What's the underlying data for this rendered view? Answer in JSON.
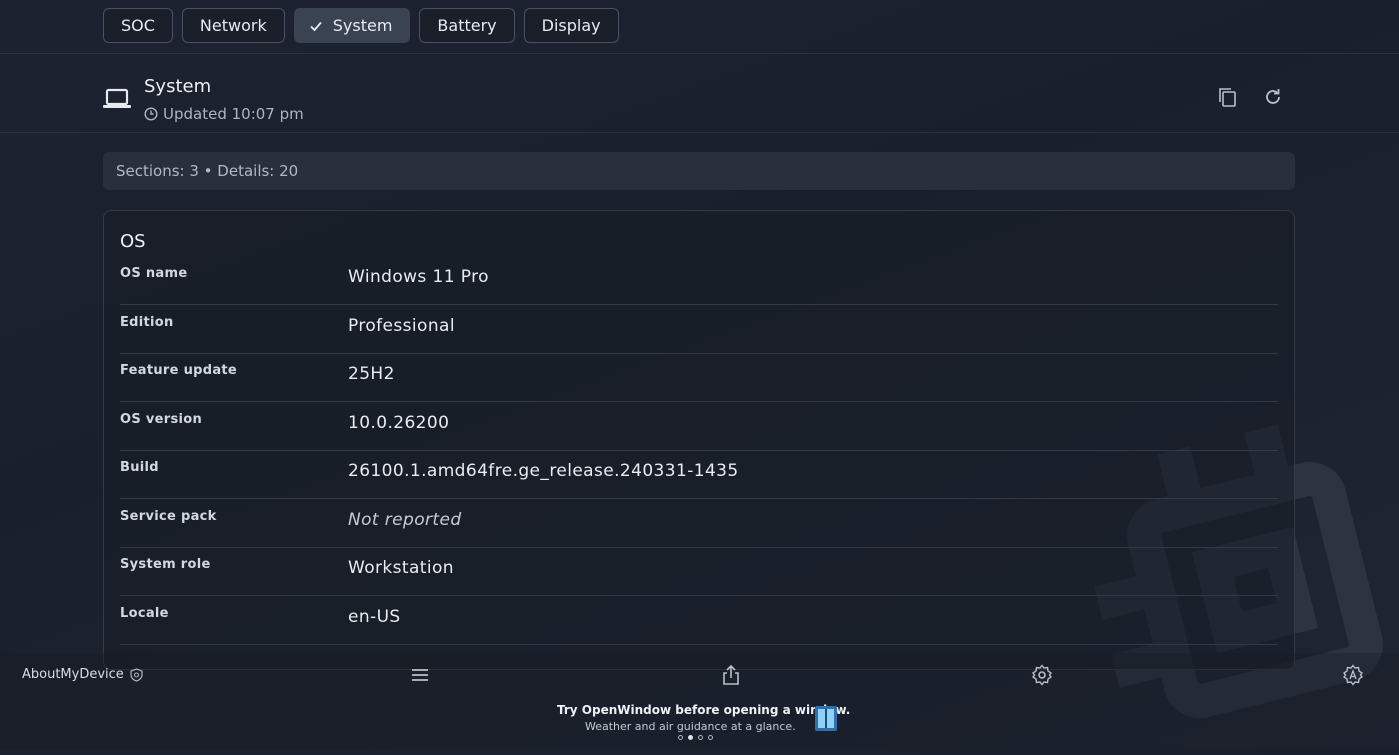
{
  "tabs": [
    {
      "label": "SOC",
      "active": false
    },
    {
      "label": "Network",
      "active": false
    },
    {
      "label": "System",
      "active": true
    },
    {
      "label": "Battery",
      "active": false
    },
    {
      "label": "Display",
      "active": false
    }
  ],
  "header": {
    "title": "System",
    "updated": "Updated 10:07 pm"
  },
  "summary": "Sections: 3 • Details: 20",
  "section": {
    "title": "OS",
    "rows": [
      {
        "label": "OS name",
        "value": "Windows 11 Pro"
      },
      {
        "label": "Edition",
        "value": "Professional"
      },
      {
        "label": "Feature update",
        "value": "25H2"
      },
      {
        "label": "OS version",
        "value": "10.0.26200"
      },
      {
        "label": "Build",
        "value": "26100.1.amd64fre.ge_release.240331-1435"
      },
      {
        "label": "Service pack",
        "value": "Not reported"
      },
      {
        "label": "System role",
        "value": "Workstation"
      },
      {
        "label": "Locale",
        "value": "en-US"
      }
    ]
  },
  "footer": {
    "app_name": "AboutMyDevice",
    "promo_title": "Try OpenWindow before opening a window.",
    "promo_subtitle": "Weather and air guidance at a glance.",
    "carousel_active_index": 1
  },
  "icons": {
    "tab_check": "check-icon",
    "laptop": "laptop-icon",
    "clock": "clock-icon",
    "copy": "copy-icon",
    "refresh": "refresh-icon",
    "shield": "shield-icon",
    "menu": "menu-icon",
    "share": "share-icon",
    "settings": "gear-icon",
    "app_settings": "gear-a-icon"
  },
  "colors": {
    "background": "#1c2230",
    "active_tab": "#3a4352",
    "summary_bg": "#2a303b",
    "border": "#343b48"
  }
}
